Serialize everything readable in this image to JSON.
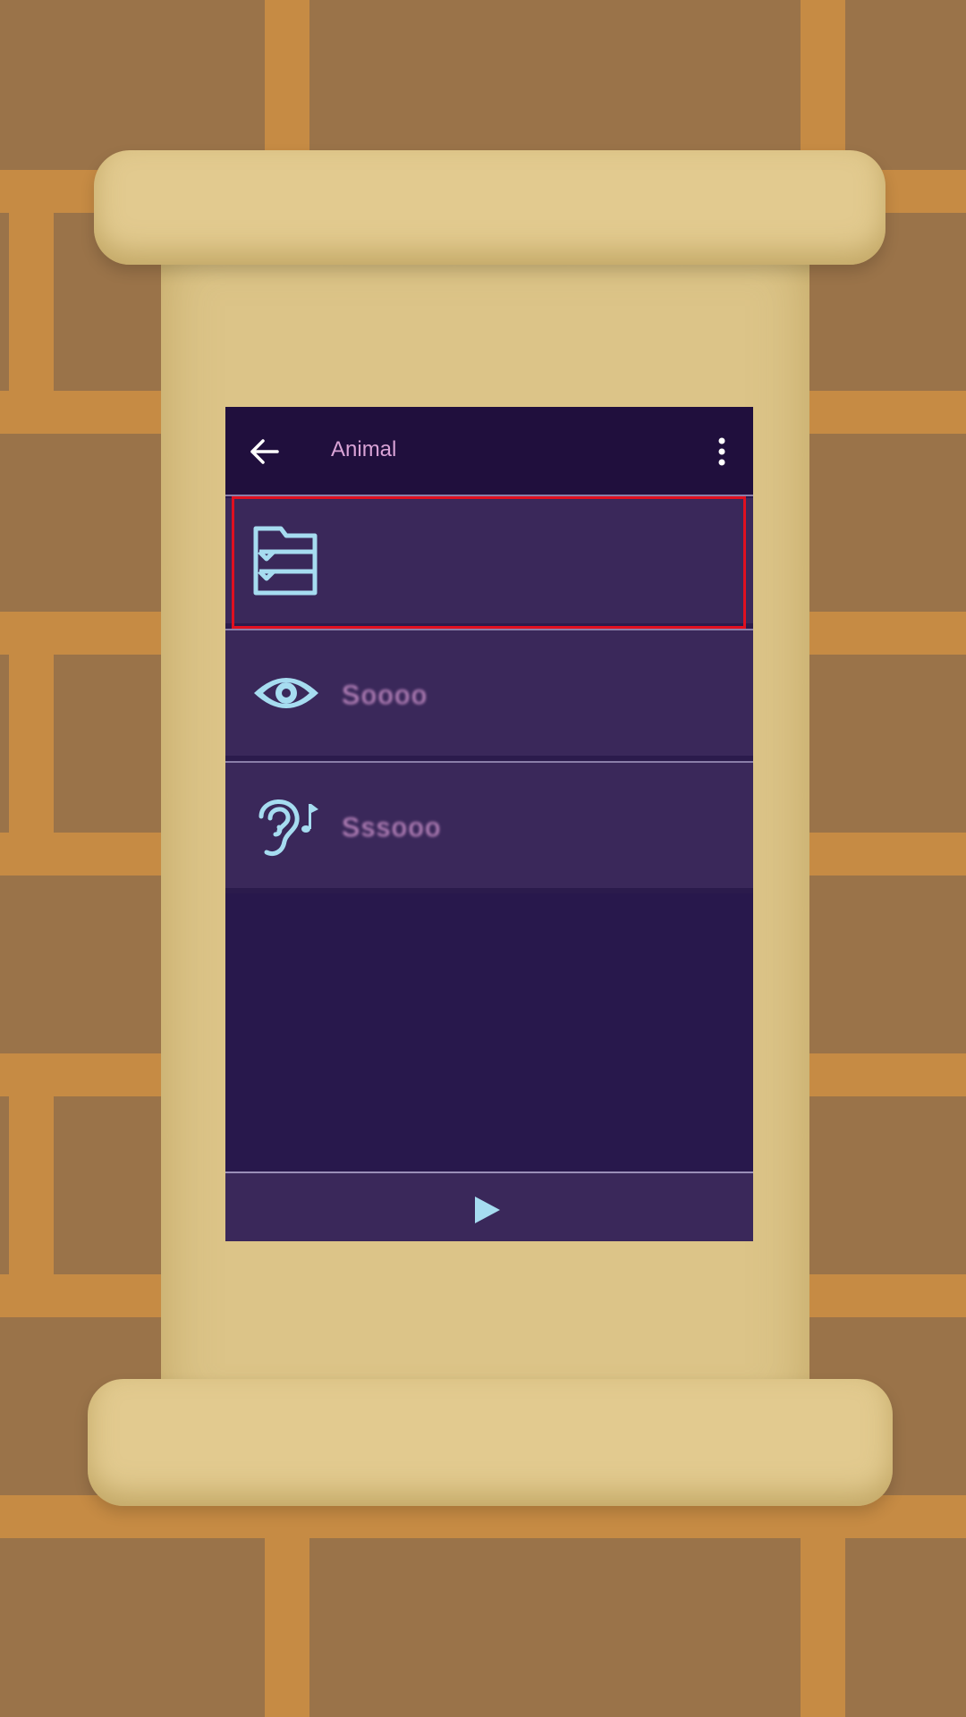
{
  "appbar": {
    "title": "Animal"
  },
  "menu_items": [
    {
      "icon": "list-folder-icon",
      "label": ""
    },
    {
      "icon": "eye-icon",
      "label": "Soooo"
    },
    {
      "icon": "ear-music-icon",
      "label": "Sssooo"
    }
  ],
  "colors": {
    "accent": "#a6dcf0",
    "appbar_bg": "#200f3d",
    "panel_bg": "#28184c",
    "row_bg": "#3a285a",
    "title_text": "#d9a3d6",
    "highlight": "#e01020"
  }
}
